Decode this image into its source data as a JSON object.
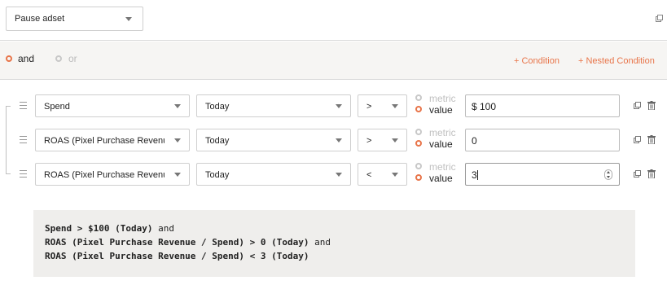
{
  "action": {
    "selected": "Pause adset"
  },
  "logic": {
    "and_label": "and",
    "or_label": "or",
    "selected": "and"
  },
  "links": {
    "add_condition": "+ Condition",
    "add_nested_condition": "+ Nested Condition"
  },
  "rules": [
    {
      "field": "Spend",
      "window": "Today",
      "operator": ">",
      "metric_label": "metric",
      "value_label": "value",
      "mode": "value",
      "value": "$ 100"
    },
    {
      "field": "ROAS (Pixel Purchase Revenue / Spend)",
      "window": "Today",
      "operator": ">",
      "metric_label": "metric",
      "value_label": "value",
      "mode": "value",
      "value": "0"
    },
    {
      "field": "ROAS (Pixel Purchase Revenue / Spend)",
      "window": "Today",
      "operator": "<",
      "metric_label": "metric",
      "value_label": "value",
      "mode": "value",
      "value": "3"
    }
  ],
  "summary": {
    "line1_code": "Spend > $100 (Today)",
    "line1_join": " and",
    "line2_code": "ROAS (Pixel Purchase Revenue / Spend) > 0 (Today)",
    "line2_join": " and",
    "line3_code": "ROAS (Pixel Purchase Revenue / Spend) < 3 (Today)"
  },
  "colors": {
    "accent": "#e8754a",
    "muted": "#c0c0c0",
    "panel": "#f6f5f3",
    "summary_bg": "#efeeec"
  },
  "icons": {
    "copy": "copy-icon",
    "trash": "trash-icon",
    "drag": "drag-handle-icon",
    "dropdown": "chevron-down-icon"
  }
}
